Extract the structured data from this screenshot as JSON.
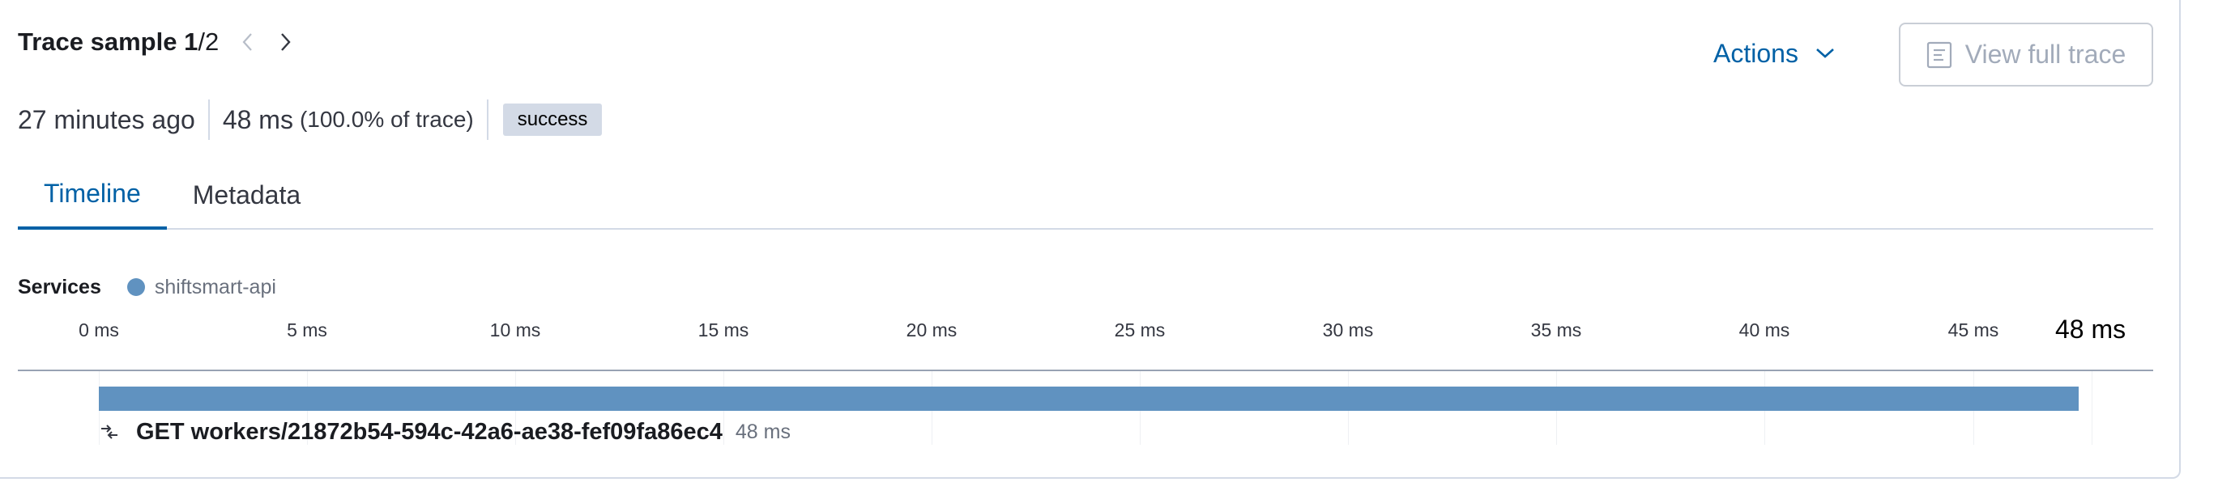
{
  "header": {
    "title_prefix": "Trace sample ",
    "sample_current": "1",
    "sample_total": "/2"
  },
  "toolbar": {
    "actions_label": "Actions",
    "view_full_trace_label": "View full trace"
  },
  "summary": {
    "time_ago": "27 minutes ago",
    "duration": "48 ms",
    "percent_of_trace": "(100.0% of trace)",
    "outcome_badge": "success"
  },
  "tabs": [
    {
      "label": "Timeline",
      "active": true
    },
    {
      "label": "Metadata",
      "active": false
    }
  ],
  "services": {
    "label": "Services",
    "items": [
      {
        "name": "shiftsmart-api",
        "color": "#6092c0"
      }
    ]
  },
  "timeline": {
    "ticks": [
      "0 ms",
      "5 ms",
      "10 ms",
      "15 ms",
      "20 ms",
      "25 ms",
      "30 ms",
      "35 ms",
      "40 ms",
      "45 ms"
    ],
    "end_label": "48 ms",
    "total_ms": 48
  },
  "spans": [
    {
      "name": "GET workers/21872b54-594c-42a6-ae38-fef09fa86ec4",
      "duration": "48 ms",
      "start_ms": 0,
      "duration_ms": 48,
      "icon": "http-request-icon"
    }
  ],
  "colors": {
    "accent": "#0061a6",
    "service": "#6092c0",
    "badge_bg": "#d3dae6"
  }
}
